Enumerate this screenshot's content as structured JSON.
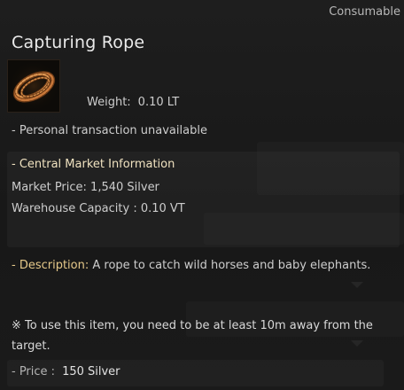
{
  "item": {
    "type": "Consumable",
    "name": "Capturing Rope",
    "icon": "rope-coil-icon",
    "weight_label": "Weight:",
    "weight_value": "0.10 LT",
    "transaction_note": "- Personal transaction unavailable"
  },
  "market": {
    "title": "- Central Market Information",
    "price_line": "Market Price: 1,540 Silver",
    "capacity_line": "Warehouse Capacity : 0.10 VT"
  },
  "description": {
    "label": "- Description: ",
    "text": "A rope to catch wild horses and baby elephants."
  },
  "usage_note": "※ To use this item, you need to be at least 10m away from the target.",
  "price": {
    "label": "- Price :",
    "value": "150 Silver"
  },
  "colors": {
    "title": "#eaeaea",
    "market_title": "#f0e2c0",
    "description_label": "#e6c98a",
    "background": "#1b1b1b"
  }
}
